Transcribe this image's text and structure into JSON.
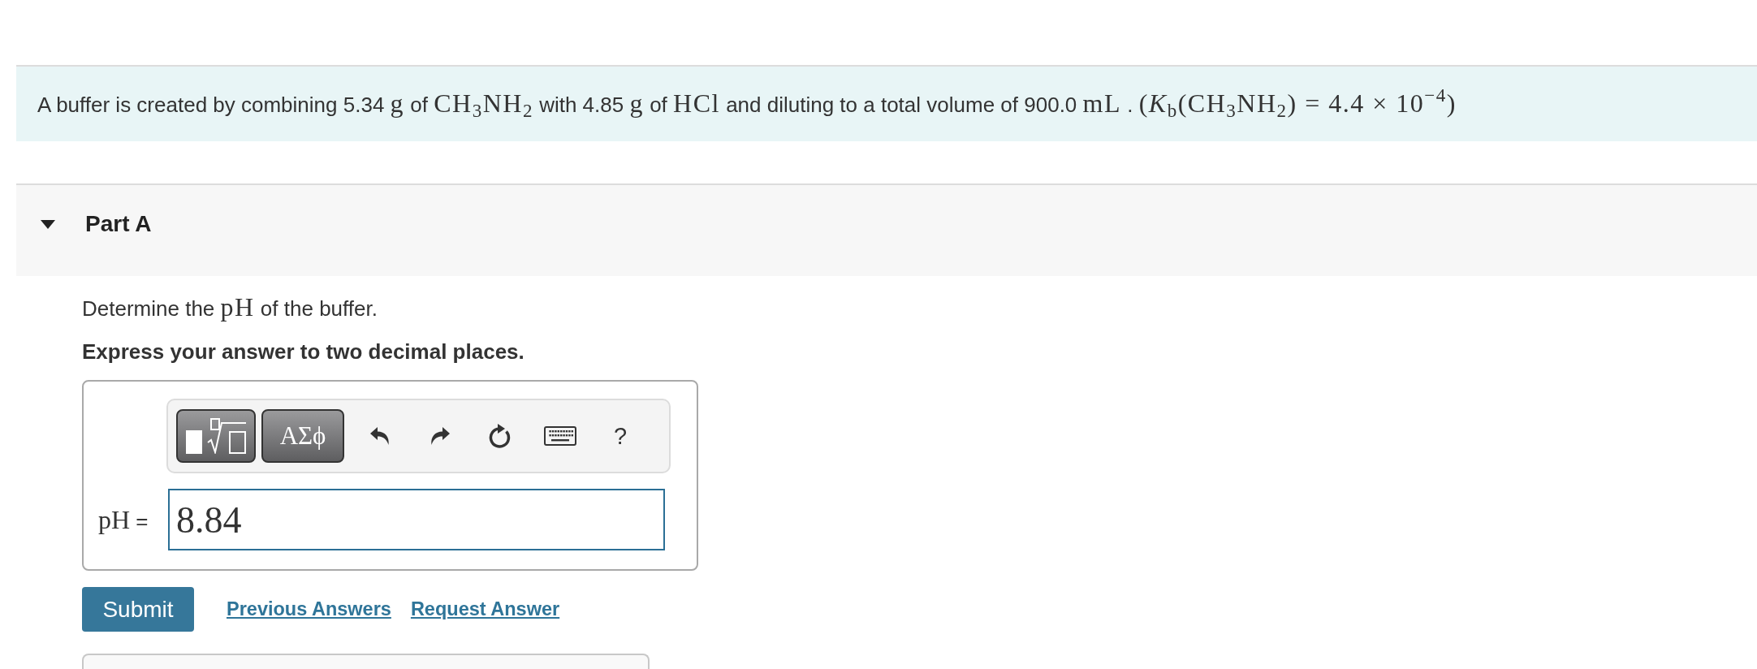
{
  "problem": {
    "statement": [
      {
        "kind": "text",
        "text": "A buffer is created by combining 5.34 "
      },
      {
        "kind": "math",
        "text": "g"
      },
      {
        "kind": "text",
        "text": " of "
      },
      {
        "kind": "math",
        "text": "CH$_{3}$NH$_{2}$"
      },
      {
        "kind": "text",
        "text": " with 4.85 "
      },
      {
        "kind": "math",
        "text": "g"
      },
      {
        "kind": "text",
        "text": " of "
      },
      {
        "kind": "math",
        "text": "HCl"
      },
      {
        "kind": "text",
        "text": " and diluting to a total volume of 900.0 "
      },
      {
        "kind": "math",
        "text": "mL"
      },
      {
        "kind": "text",
        "text": " . "
      },
      {
        "kind": "math",
        "text": "(*K*$_{b}$(CH$_{3}$NH$_{2}$) = 4.4 × 10$^{−4}$)"
      }
    ]
  },
  "part": {
    "title": "Part A",
    "expanded": true
  },
  "question": {
    "prompt": [
      {
        "kind": "text",
        "text": "Determine the "
      },
      {
        "kind": "math",
        "text": "pH"
      },
      {
        "kind": "text",
        "text": " of the buffer."
      }
    ],
    "instruction": "Express your answer to two decimal places."
  },
  "answer_box": {
    "toolbar": [
      {
        "kind": "templates"
      },
      {
        "kind": "symbols",
        "label": "ΑΣϕ"
      },
      {
        "kind": "undo"
      },
      {
        "kind": "redo"
      },
      {
        "kind": "reset"
      },
      {
        "kind": "keyboard"
      },
      {
        "kind": "help",
        "label": "?"
      }
    ],
    "label": [
      {
        "kind": "math",
        "text": "pH"
      },
      {
        "kind": "text",
        "text": " ="
      }
    ],
    "value": "8.84"
  },
  "actions": {
    "submit": "Submit",
    "previous_answers": "Previous Answers",
    "request_answer": "Request Answer"
  }
}
